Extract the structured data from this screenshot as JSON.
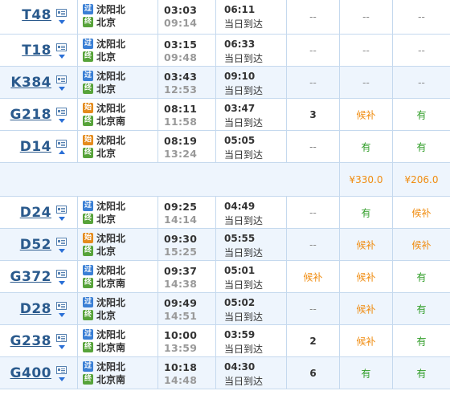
{
  "columns": [
    "c1",
    "c2",
    "c3"
  ],
  "rows": [
    {
      "type": "train",
      "train": "T48",
      "arrow": "down",
      "from_badge": "过",
      "from_badge_type": "pass",
      "from": "沈阳北",
      "to_badge": "终",
      "to_badge_type": "end",
      "to": "北京",
      "depart": "03:03",
      "arrive": "09:14",
      "duration": "06:11",
      "day_note": "当日到达",
      "c1": "--",
      "c2": "--",
      "c3": "--",
      "alt": false,
      "first": true
    },
    {
      "type": "train",
      "train": "T18",
      "arrow": "down",
      "from_badge": "过",
      "from_badge_type": "pass",
      "from": "沈阳北",
      "to_badge": "终",
      "to_badge_type": "end",
      "to": "北京",
      "depart": "03:15",
      "arrive": "09:48",
      "duration": "06:33",
      "day_note": "当日到达",
      "c1": "--",
      "c2": "--",
      "c3": "--",
      "alt": false
    },
    {
      "type": "train",
      "train": "K384",
      "arrow": "down",
      "from_badge": "过",
      "from_badge_type": "pass",
      "from": "沈阳北",
      "to_badge": "终",
      "to_badge_type": "end",
      "to": "北京",
      "depart": "03:43",
      "arrive": "12:53",
      "duration": "09:10",
      "day_note": "当日到达",
      "c1": "--",
      "c2": "--",
      "c3": "--",
      "alt": true
    },
    {
      "type": "train",
      "train": "G218",
      "arrow": "down",
      "from_badge": "始",
      "from_badge_type": "start",
      "from": "沈阳北",
      "to_badge": "终",
      "to_badge_type": "end",
      "to": "北京南",
      "depart": "08:11",
      "arrive": "11:58",
      "duration": "03:47",
      "day_note": "当日到达",
      "c1": "3",
      "c2": "候补",
      "c3": "有",
      "alt": false
    },
    {
      "type": "train",
      "train": "D14",
      "arrow": "up",
      "from_badge": "始",
      "from_badge_type": "start",
      "from": "沈阳北",
      "to_badge": "终",
      "to_badge_type": "end",
      "to": "北京",
      "depart": "08:19",
      "arrive": "13:24",
      "duration": "05:05",
      "day_note": "当日到达",
      "c1": "--",
      "c2": "有",
      "c3": "有",
      "alt": false
    },
    {
      "type": "price",
      "c1": "",
      "c2": "¥330.0",
      "c3": "¥206.0"
    },
    {
      "type": "train",
      "train": "D24",
      "arrow": "down",
      "from_badge": "过",
      "from_badge_type": "pass",
      "from": "沈阳北",
      "to_badge": "终",
      "to_badge_type": "end",
      "to": "北京",
      "depart": "09:25",
      "arrive": "14:14",
      "duration": "04:49",
      "day_note": "当日到达",
      "c1": "--",
      "c2": "有",
      "c3": "候补",
      "alt": false
    },
    {
      "type": "train",
      "train": "D52",
      "arrow": "down",
      "from_badge": "始",
      "from_badge_type": "start",
      "from": "沈阳北",
      "to_badge": "终",
      "to_badge_type": "end",
      "to": "北京",
      "depart": "09:30",
      "arrive": "15:25",
      "duration": "05:55",
      "day_note": "当日到达",
      "c1": "--",
      "c2": "候补",
      "c3": "候补",
      "alt": true
    },
    {
      "type": "train",
      "train": "G372",
      "arrow": "down",
      "from_badge": "过",
      "from_badge_type": "pass",
      "from": "沈阳北",
      "to_badge": "终",
      "to_badge_type": "end",
      "to": "北京南",
      "depart": "09:37",
      "arrive": "14:38",
      "duration": "05:01",
      "day_note": "当日到达",
      "c1": "候补",
      "c2": "候补",
      "c3": "有",
      "alt": false
    },
    {
      "type": "train",
      "train": "D28",
      "arrow": "down",
      "from_badge": "过",
      "from_badge_type": "pass",
      "from": "沈阳北",
      "to_badge": "终",
      "to_badge_type": "end",
      "to": "北京",
      "depart": "09:49",
      "arrive": "14:51",
      "duration": "05:02",
      "day_note": "当日到达",
      "c1": "--",
      "c2": "候补",
      "c3": "有",
      "alt": true
    },
    {
      "type": "train",
      "train": "G238",
      "arrow": "down",
      "from_badge": "过",
      "from_badge_type": "pass",
      "from": "沈阳北",
      "to_badge": "终",
      "to_badge_type": "end",
      "to": "北京南",
      "depart": "10:00",
      "arrive": "13:59",
      "duration": "03:59",
      "day_note": "当日到达",
      "c1": "2",
      "c2": "候补",
      "c3": "有",
      "alt": false
    },
    {
      "type": "train",
      "train": "G400",
      "arrow": "down",
      "from_badge": "过",
      "from_badge_type": "pass",
      "from": "沈阳北",
      "to_badge": "终",
      "to_badge_type": "end",
      "to": "北京南",
      "depart": "10:18",
      "arrive": "14:48",
      "duration": "04:30",
      "day_note": "当日到达",
      "c1": "6",
      "c2": "有",
      "c3": "有",
      "alt": true
    }
  ],
  "colors": {
    "available": "#2f9d27",
    "waitlist": "#f08c10",
    "train_number": "#2a5a8d",
    "border": "#c5d9ee",
    "alt_row": "#eef5fd"
  }
}
